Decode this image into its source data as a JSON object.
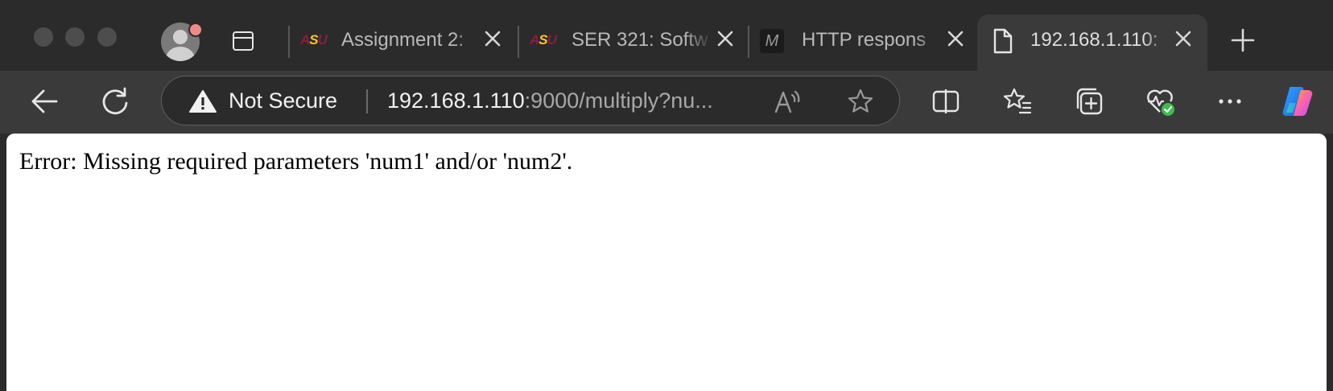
{
  "window": {
    "traffic_lights": [
      "close",
      "minimize",
      "zoom"
    ]
  },
  "tabs": [
    {
      "title": "Assignment 2: ",
      "favicon": "asu-logo-icon",
      "active": false
    },
    {
      "title": "SER 321: Softw",
      "favicon": "asu-logo-icon",
      "active": false
    },
    {
      "title": "HTTP respons",
      "favicon": "mdn-logo-icon",
      "active": false
    },
    {
      "title": "192.168.1.110:",
      "favicon": "document-icon",
      "active": true
    }
  ],
  "favicon_text": {
    "asu_left": "A",
    "asu_mid": "S",
    "asu_right": "U",
    "mdn": "M"
  },
  "addressbar": {
    "security_label": "Not Secure",
    "url_host": "192.168.1.110",
    "url_rest": ":9000/multiply?nu..."
  },
  "toolbar_icons": [
    "back-icon",
    "refresh-icon",
    "read-aloud-icon",
    "favorite-star-icon",
    "split-screen-icon",
    "favorites-icon",
    "collections-icon",
    "browser-essentials-icon",
    "more-icon",
    "copilot-icon"
  ],
  "colors": {
    "asu_maroon": "#8c1d40",
    "asu_gold": "#ffc627",
    "essentials_badge": "#3fb950"
  },
  "page": {
    "message": "Error: Missing required parameters 'num1' and/or 'num2'."
  }
}
